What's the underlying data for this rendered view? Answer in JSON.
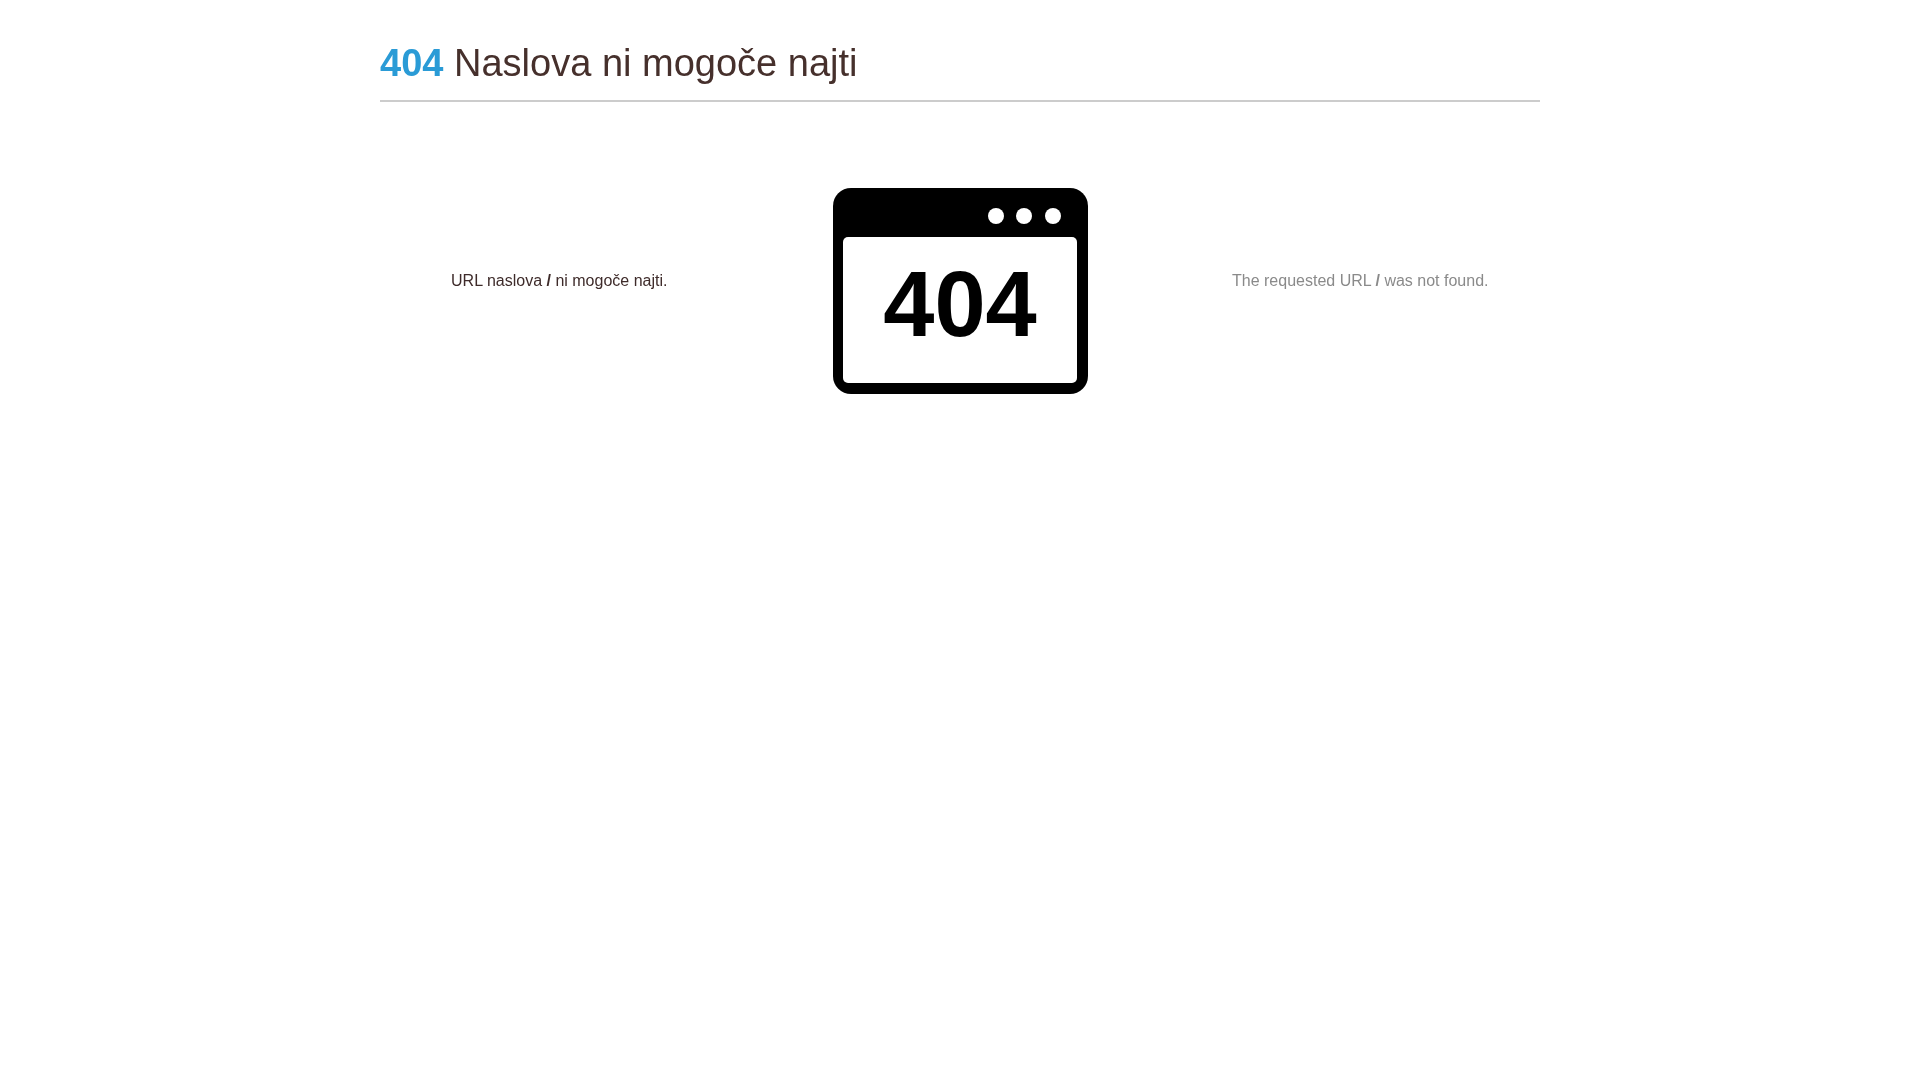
{
  "header": {
    "code": "404",
    "title": "Naslova ni mogoče najti"
  },
  "content": {
    "message": "URL naslova **/** ni mogoče najti.",
    "illustration": {
      "label": "404"
    },
    "translation": "The requested URL **/** was not found."
  }
}
